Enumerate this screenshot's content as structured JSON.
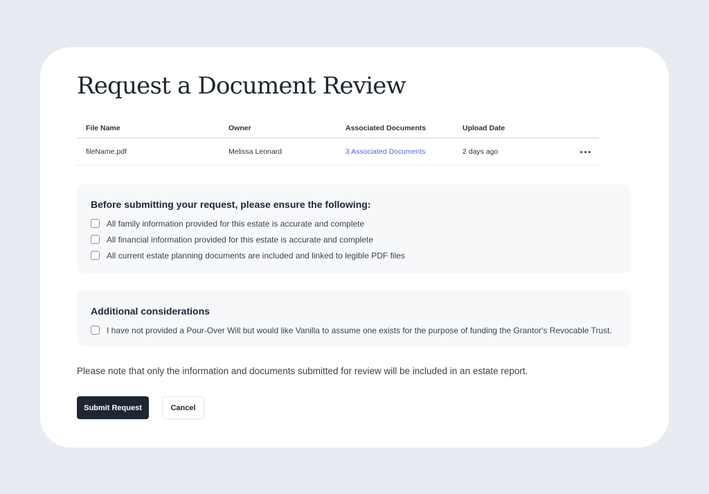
{
  "title": "Request a Document Review",
  "table": {
    "headers": [
      "File Name",
      "Owner",
      "Associated Documents",
      "Upload Date"
    ],
    "rows": [
      {
        "file_name": "fileName.pdf",
        "owner": "Melissa Leonard",
        "associated_documents": "3 Associated Documents",
        "upload_date": "2 days ago",
        "actions_icon": "more-horizontal-icon"
      }
    ]
  },
  "checklist": {
    "heading": "Before submitting your request, please ensure the following:",
    "items": [
      {
        "label": "All family information provided for this estate is accurate and complete",
        "checked": false
      },
      {
        "label": "All financial information provided for this estate is accurate and complete",
        "checked": false
      },
      {
        "label": "All current estate planning documents are included and linked to legible PDF files",
        "checked": false
      }
    ]
  },
  "additional": {
    "heading": "Additional considerations",
    "items": [
      {
        "label": "I have not provided a Pour-Over Will but would like Vanilla to assume one exists for the purpose of funding the Grantor's Revocable Trust.",
        "checked": false
      }
    ]
  },
  "note": "Please note that only the information and documents submitted for review will be included in an estate report.",
  "actions": {
    "submit_label": "Submit Request",
    "cancel_label": "Cancel"
  },
  "colors": {
    "background": "#e8ebf2",
    "card": "#ffffff",
    "primary_button": "#1e2633",
    "link": "#4f6ad6",
    "panel": "#f7f8fa"
  }
}
